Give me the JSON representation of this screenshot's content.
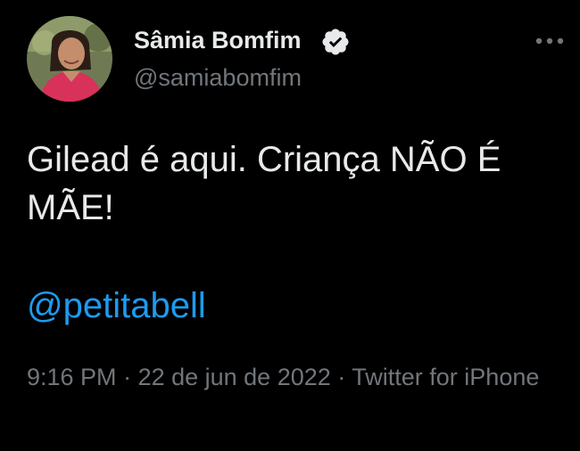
{
  "tweet": {
    "author": {
      "display_name": "Sâmia Bomfim",
      "handle": "@samiabomfim",
      "verified": true,
      "avatar_icon": "user-avatar-photo"
    },
    "text": "Gilead é aqui. Criança NÃO É MÃE!",
    "mention": "@petitabell",
    "meta": {
      "time": "9:16 PM",
      "separator_1": " · ",
      "date": "22 de jun de 2022",
      "separator_2": " · ",
      "source": "Twitter for iPhone"
    },
    "more_icon": "more-horizontal-icon"
  },
  "colors": {
    "background": "#000000",
    "text_primary": "#e7e9ea",
    "text_secondary": "#71767b",
    "link": "#1d9bf0",
    "verified_badge": "#e7e9ea"
  }
}
